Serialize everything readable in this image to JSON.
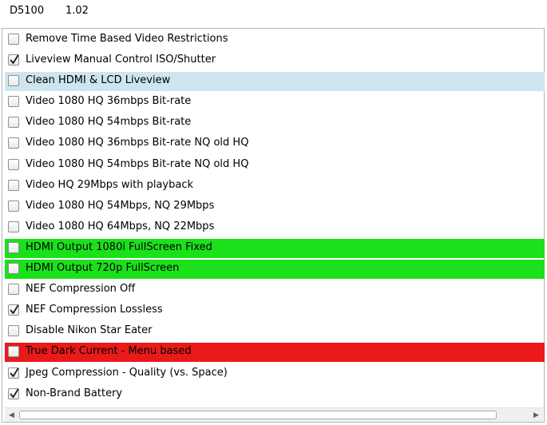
{
  "header": {
    "model": "D5100",
    "version": "1.02"
  },
  "colors": {
    "light_blue": "#cde5ee",
    "green": "#1be11b",
    "red": "#ea1a1a"
  },
  "items": [
    {
      "label": "Remove Time Based Video Restrictions",
      "checked": false,
      "highlight": "none"
    },
    {
      "label": "Liveview Manual Control ISO/Shutter",
      "checked": true,
      "highlight": "none"
    },
    {
      "label": "Clean HDMI & LCD Liveview",
      "checked": false,
      "highlight": "light_blue"
    },
    {
      "label": "Video 1080 HQ 36mbps Bit-rate",
      "checked": false,
      "highlight": "none"
    },
    {
      "label": "Video 1080 HQ 54mbps Bit-rate",
      "checked": false,
      "highlight": "none"
    },
    {
      "label": "Video 1080 HQ 36mbps Bit-rate NQ old HQ",
      "checked": false,
      "highlight": "none"
    },
    {
      "label": "Video 1080 HQ 54mbps Bit-rate NQ old HQ",
      "checked": false,
      "highlight": "none"
    },
    {
      "label": "Video HQ 29Mbps with playback",
      "checked": false,
      "highlight": "none"
    },
    {
      "label": "Video 1080 HQ 54Mbps, NQ 29Mbps",
      "checked": false,
      "highlight": "none"
    },
    {
      "label": "Video 1080 HQ 64Mbps, NQ 22Mbps",
      "checked": false,
      "highlight": "none"
    },
    {
      "label": "HDMI Output 1080i FullScreen Fixed",
      "checked": false,
      "highlight": "green"
    },
    {
      "label": "HDMI Output 720p FullScreen",
      "checked": false,
      "highlight": "green"
    },
    {
      "label": "NEF Compression Off",
      "checked": false,
      "highlight": "none"
    },
    {
      "label": "NEF Compression Lossless",
      "checked": true,
      "highlight": "none"
    },
    {
      "label": "Disable Nikon Star Eater",
      "checked": false,
      "highlight": "none"
    },
    {
      "label": "True Dark Current - Menu based",
      "checked": false,
      "highlight": "red"
    },
    {
      "label": "Jpeg Compression - Quality (vs. Space)",
      "checked": true,
      "highlight": "none"
    },
    {
      "label": "Non-Brand Battery",
      "checked": true,
      "highlight": "none"
    }
  ],
  "scrollbar": {
    "left_arrow": "◀",
    "right_arrow": "▶"
  }
}
